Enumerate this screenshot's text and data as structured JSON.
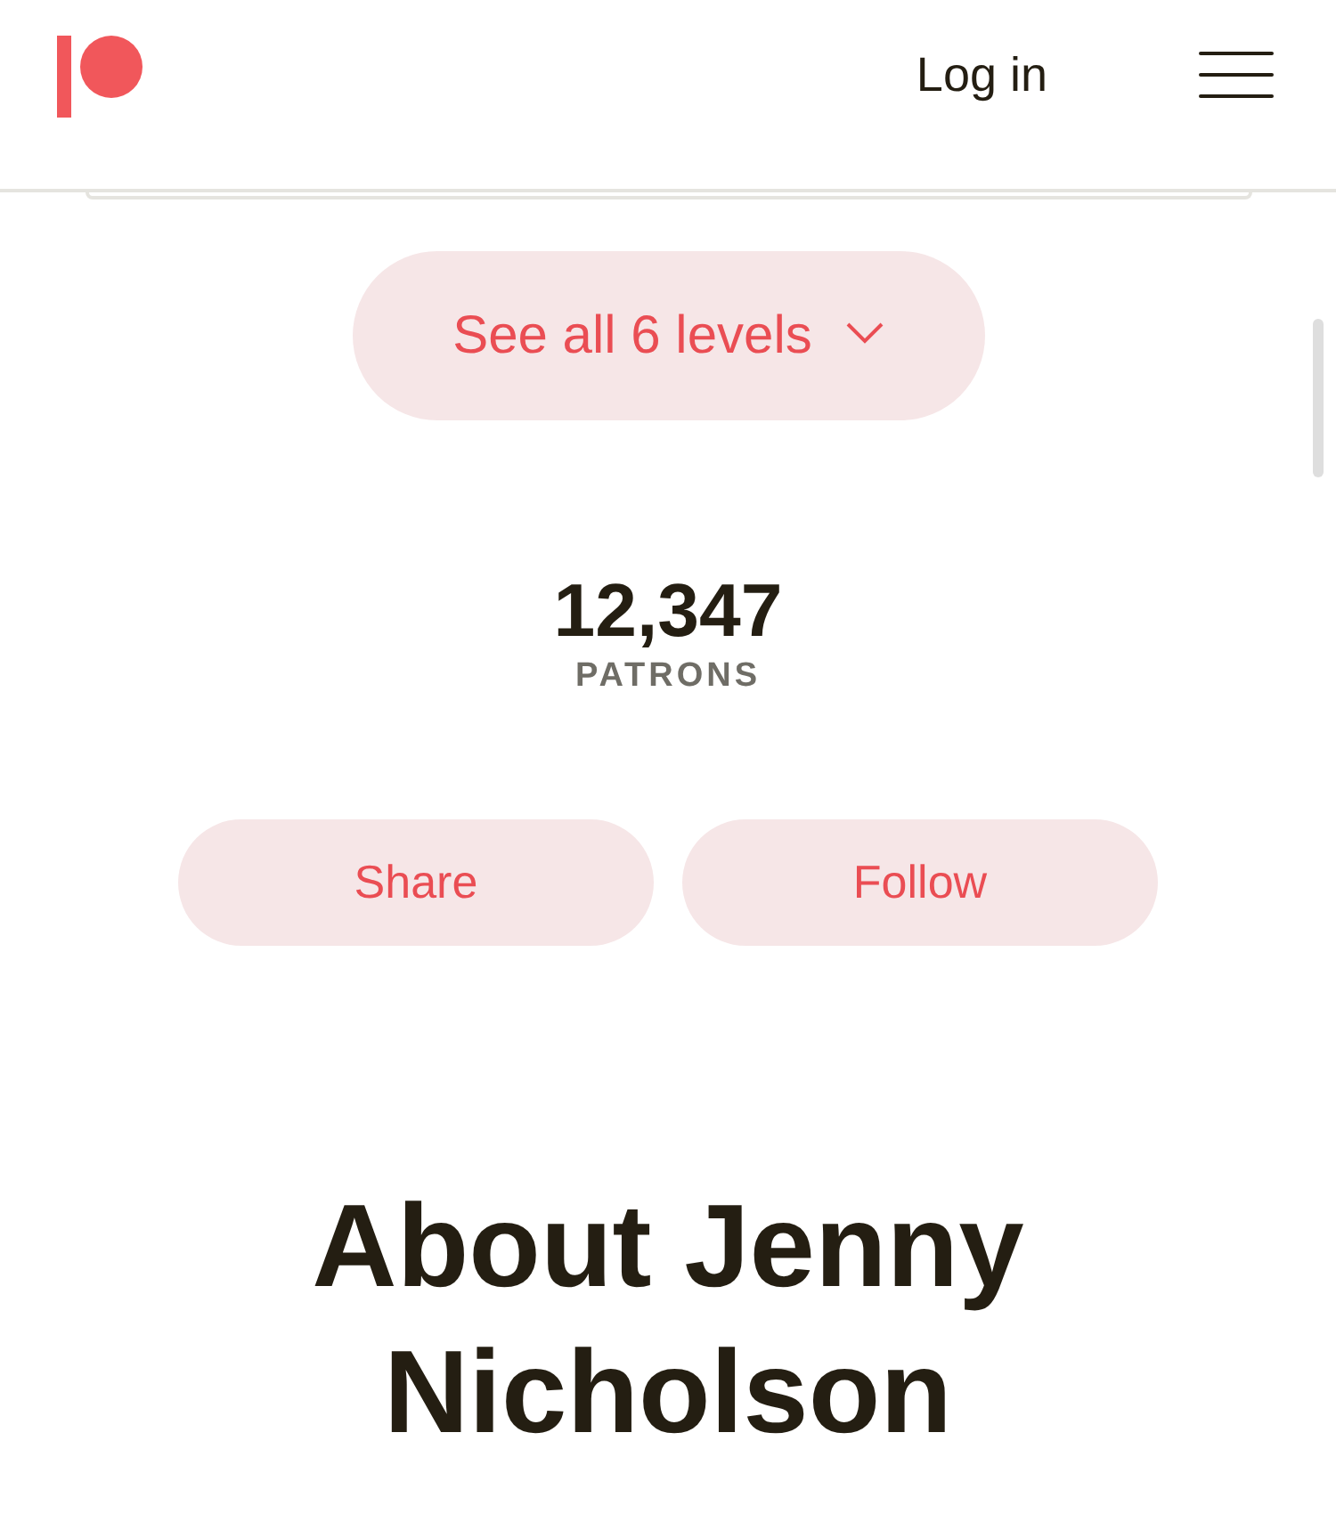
{
  "header": {
    "login_link": "Log in"
  },
  "tiers": {
    "see_all_button": "See all 6 levels"
  },
  "stats": {
    "count": "12,347",
    "label": "PATRONS"
  },
  "actions": [
    "Share",
    "Follow"
  ],
  "about": {
    "heading": "About Jenny Nicholson"
  }
}
